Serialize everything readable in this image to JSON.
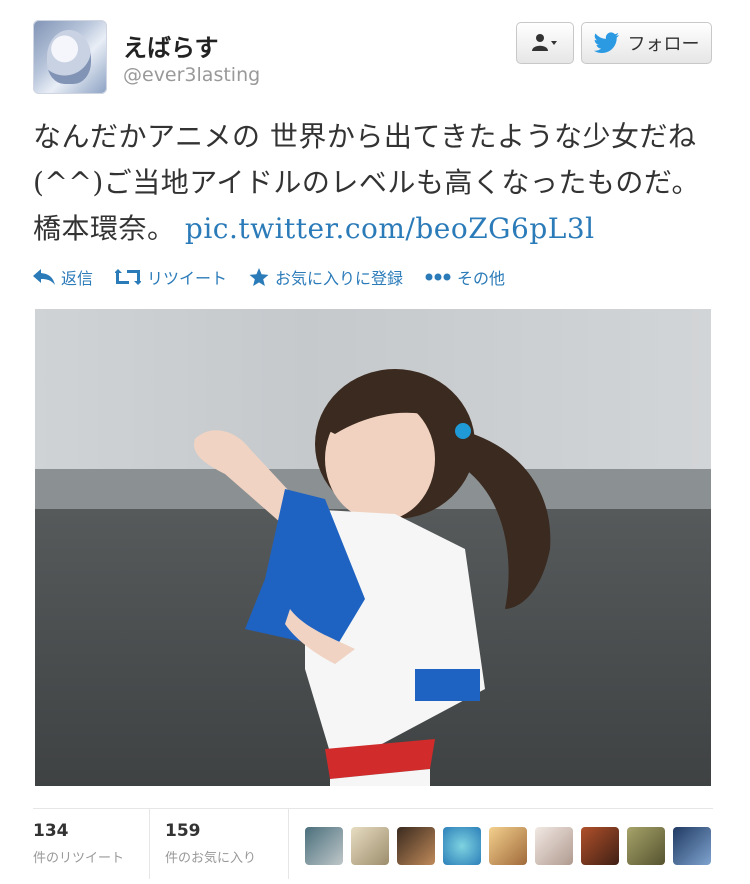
{
  "user": {
    "name": "えばらす",
    "handle": "@ever3lasting"
  },
  "buttons": {
    "follow_label": "フォロー"
  },
  "tweet": {
    "text": "なんだかアニメの 世界から出てきたような少女だね(^^)ご当地アイドルのレベルも高くなったものだ。橋本環奈。",
    "link": "pic.twitter.com/beoZG6pL3l"
  },
  "actions": [
    {
      "label": "返信",
      "icon": "reply-icon"
    },
    {
      "label": "リツイート",
      "icon": "retweet-icon"
    },
    {
      "label": "お気に入りに登録",
      "icon": "star-icon"
    },
    {
      "label": "その他",
      "icon": "more-icon"
    }
  ],
  "stats": {
    "retweets": {
      "count": "134",
      "label": "件のリツイート"
    },
    "favorites": {
      "count": "159",
      "label": "件のお気に入り"
    }
  },
  "colors": {
    "accent": "#2b7bb9"
  }
}
